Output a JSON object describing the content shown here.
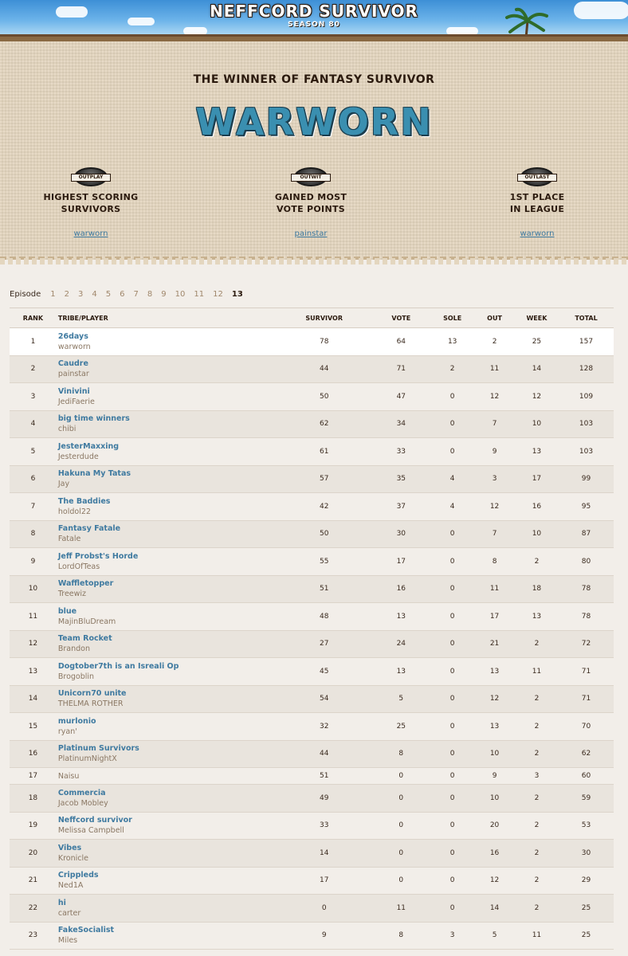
{
  "header": {
    "title": "NEFFCORD SURVIVOR",
    "subtitle": "SEASON 80"
  },
  "banner": {
    "heading": "THE WINNER OF FANTASY SURVIVOR",
    "winner": "WARWORN",
    "awards": [
      {
        "badge": "OUTPLAY",
        "title_line1": "HIGHEST SCORING",
        "title_line2": "SURVIVORS",
        "link": "warworn"
      },
      {
        "badge": "OUTWIT",
        "title_line1": "GAINED MOST",
        "title_line2": "VOTE POINTS",
        "link": "painstar"
      },
      {
        "badge": "OUTLAST",
        "title_line1": "1ST PLACE",
        "title_line2": "IN LEAGUE",
        "link": "warworn"
      }
    ]
  },
  "episodes": {
    "label": "Episode",
    "items": [
      "1",
      "2",
      "3",
      "4",
      "5",
      "6",
      "7",
      "8",
      "9",
      "10",
      "11",
      "12",
      "13"
    ],
    "active": "13"
  },
  "table": {
    "headers": {
      "rank": "RANK",
      "tribe": "TRIBE/PLAYER",
      "survivor": "SURVIVOR",
      "vote": "VOTE",
      "sole": "SOLE",
      "out": "OUT",
      "week": "WEEK",
      "total": "TOTAL"
    },
    "rows": [
      {
        "rank": "1",
        "tribe": "26days",
        "player": "warworn",
        "survivor": "78",
        "vote": "64",
        "sole": "13",
        "out": "2",
        "week": "25",
        "total": "157"
      },
      {
        "rank": "2",
        "tribe": "Caudre",
        "player": "painstar",
        "survivor": "44",
        "vote": "71",
        "sole": "2",
        "out": "11",
        "week": "14",
        "total": "128"
      },
      {
        "rank": "3",
        "tribe": "Vinivini",
        "player": "JediFaerie",
        "survivor": "50",
        "vote": "47",
        "sole": "0",
        "out": "12",
        "week": "12",
        "total": "109"
      },
      {
        "rank": "4",
        "tribe": "big time winners",
        "player": "chibi",
        "survivor": "62",
        "vote": "34",
        "sole": "0",
        "out": "7",
        "week": "10",
        "total": "103"
      },
      {
        "rank": "5",
        "tribe": "JesterMaxxing",
        "player": "Jesterdude",
        "survivor": "61",
        "vote": "33",
        "sole": "0",
        "out": "9",
        "week": "13",
        "total": "103"
      },
      {
        "rank": "6",
        "tribe": "Hakuna My Tatas",
        "player": "Jay",
        "survivor": "57",
        "vote": "35",
        "sole": "4",
        "out": "3",
        "week": "17",
        "total": "99"
      },
      {
        "rank": "7",
        "tribe": "The Baddies",
        "player": "holdol22",
        "survivor": "42",
        "vote": "37",
        "sole": "4",
        "out": "12",
        "week": "16",
        "total": "95"
      },
      {
        "rank": "8",
        "tribe": "Fantasy Fatale",
        "player": "Fatale",
        "survivor": "50",
        "vote": "30",
        "sole": "0",
        "out": "7",
        "week": "10",
        "total": "87"
      },
      {
        "rank": "9",
        "tribe": "Jeff Probst's Horde",
        "player": "LordOfTeas",
        "survivor": "55",
        "vote": "17",
        "sole": "0",
        "out": "8",
        "week": "2",
        "total": "80"
      },
      {
        "rank": "10",
        "tribe": "Waffletopper",
        "player": "Treewiz",
        "survivor": "51",
        "vote": "16",
        "sole": "0",
        "out": "11",
        "week": "18",
        "total": "78"
      },
      {
        "rank": "11",
        "tribe": "blue",
        "player": "MajinBluDream",
        "survivor": "48",
        "vote": "13",
        "sole": "0",
        "out": "17",
        "week": "13",
        "total": "78"
      },
      {
        "rank": "12",
        "tribe": "Team Rocket",
        "player": "Brandon",
        "survivor": "27",
        "vote": "24",
        "sole": "0",
        "out": "21",
        "week": "2",
        "total": "72"
      },
      {
        "rank": "13",
        "tribe": "Dogtober7th is an Isreali Op",
        "player": "Brogoblin",
        "survivor": "45",
        "vote": "13",
        "sole": "0",
        "out": "13",
        "week": "11",
        "total": "71"
      },
      {
        "rank": "14",
        "tribe": "Unicorn70 unite",
        "player": "THELMA ROTHER",
        "survivor": "54",
        "vote": "5",
        "sole": "0",
        "out": "12",
        "week": "2",
        "total": "71"
      },
      {
        "rank": "15",
        "tribe": "murlonio",
        "player": "ryan'",
        "survivor": "32",
        "vote": "25",
        "sole": "0",
        "out": "13",
        "week": "2",
        "total": "70"
      },
      {
        "rank": "16",
        "tribe": "Platinum Survivors",
        "player": "PlatinumNightX",
        "survivor": "44",
        "vote": "8",
        "sole": "0",
        "out": "10",
        "week": "2",
        "total": "62"
      },
      {
        "rank": "17",
        "tribe": "",
        "player": "Naisu",
        "survivor": "51",
        "vote": "0",
        "sole": "0",
        "out": "9",
        "week": "3",
        "total": "60"
      },
      {
        "rank": "18",
        "tribe": "Commercia",
        "player": "Jacob Mobley",
        "survivor": "49",
        "vote": "0",
        "sole": "0",
        "out": "10",
        "week": "2",
        "total": "59"
      },
      {
        "rank": "19",
        "tribe": "Neffcord survivor",
        "player": "Melissa Campbell",
        "survivor": "33",
        "vote": "0",
        "sole": "0",
        "out": "20",
        "week": "2",
        "total": "53"
      },
      {
        "rank": "20",
        "tribe": "Vibes",
        "player": "Kronicle",
        "survivor": "14",
        "vote": "0",
        "sole": "0",
        "out": "16",
        "week": "2",
        "total": "30"
      },
      {
        "rank": "21",
        "tribe": "Crippleds",
        "player": "Ned1A",
        "survivor": "17",
        "vote": "0",
        "sole": "0",
        "out": "12",
        "week": "2",
        "total": "29"
      },
      {
        "rank": "22",
        "tribe": "hi",
        "player": "carter",
        "survivor": "0",
        "vote": "11",
        "sole": "0",
        "out": "14",
        "week": "2",
        "total": "25"
      },
      {
        "rank": "23",
        "tribe": "FakeSocialist",
        "player": "Miles",
        "survivor": "9",
        "vote": "8",
        "sole": "3",
        "out": "5",
        "week": "11",
        "total": "25"
      }
    ]
  },
  "colors": {
    "tribe_link": "#3f7aa0",
    "winner": "#3a8fb0",
    "banner_bg": "#e4d6bf"
  }
}
